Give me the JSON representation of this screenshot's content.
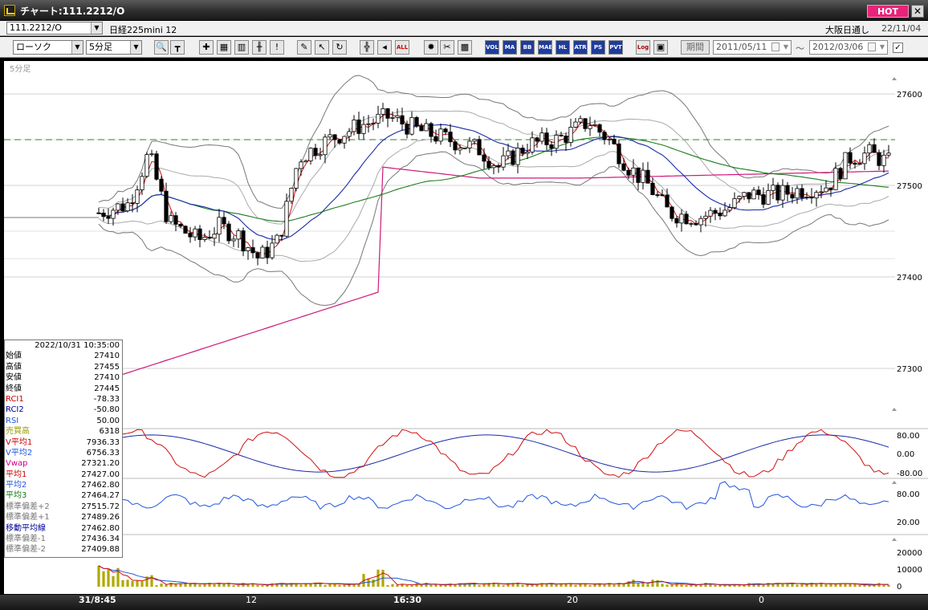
{
  "window": {
    "title": "チャート:111.2212/O",
    "hot_label": "HOT",
    "close_label": "✕"
  },
  "header": {
    "symbol": "111.2212/O",
    "instrument": "日経225mini 12",
    "session": "大阪日通し",
    "date": "22/11/04"
  },
  "toolbar": {
    "chart_type": "ローソク",
    "interval": "5分足",
    "buttons": [
      {
        "name": "zoom-icon",
        "label": "🔍"
      },
      {
        "name": "ruler-icon",
        "label": "┳"
      },
      {
        "name": "candle-select-icon",
        "label": "✚"
      },
      {
        "name": "chart-grid-icon",
        "label": "▦"
      },
      {
        "name": "bar-chart-icon",
        "label": "▥"
      },
      {
        "name": "candle-mark-icon",
        "label": "╫"
      },
      {
        "name": "warning-icon",
        "label": "!"
      },
      {
        "name": "pencil-icon",
        "label": "✎"
      },
      {
        "name": "cursor-icon",
        "label": "↖"
      },
      {
        "name": "rotate-icon",
        "label": "↻"
      },
      {
        "name": "ohlc-icon",
        "label": "╬"
      },
      {
        "name": "shift-left-icon",
        "label": "◂"
      },
      {
        "name": "all-icon",
        "label": "ALL"
      },
      {
        "name": "settings-icon",
        "label": "✹"
      },
      {
        "name": "wrench-icon",
        "label": "✂"
      },
      {
        "name": "palette-icon",
        "label": "▩"
      },
      {
        "name": "volume-icon",
        "label": "VOL"
      },
      {
        "name": "ma-icon",
        "label": "MA"
      },
      {
        "name": "bb-icon",
        "label": "BB"
      },
      {
        "name": "mae-icon",
        "label": "MAE"
      },
      {
        "name": "hl-icon",
        "label": "HL"
      },
      {
        "name": "atr-icon",
        "label": "ATR"
      },
      {
        "name": "ps-icon",
        "label": "PS"
      },
      {
        "name": "pvt-icon",
        "label": "PVT"
      },
      {
        "name": "log-icon",
        "label": "Log"
      },
      {
        "name": "chart-copy-icon",
        "label": "▣"
      }
    ],
    "period_label": "期間",
    "date_from": "2011/05/11",
    "date_to": "2012/03/06",
    "tilde": "〜",
    "check": "✓"
  },
  "chart": {
    "interval_label": "5分足",
    "price_ticks": [
      "27600",
      "27500",
      "27400",
      "27300"
    ],
    "osc_ticks": [
      "80.00",
      "0.00",
      "-80.00"
    ],
    "rsi_ticks": [
      "80.00",
      "20.00"
    ],
    "vol_ticks": [
      "20000",
      "10000",
      "0"
    ],
    "x_labels": [
      "31/8:45",
      "12",
      "16:30",
      "20",
      "0"
    ]
  },
  "data_panel": {
    "datetime": "2022/10/31  10:35:00",
    "rows": [
      {
        "k": "始値",
        "v": "27410",
        "color": "#000000"
      },
      {
        "k": "高値",
        "v": "27455",
        "color": "#000000"
      },
      {
        "k": "安値",
        "v": "27410",
        "color": "#000000"
      },
      {
        "k": "終値",
        "v": "27445",
        "color": "#000000"
      },
      {
        "k": "RCI1",
        "v": "-78.33",
        "color": "#cc0000"
      },
      {
        "k": "RCI2",
        "v": "-50.80",
        "color": "#000099"
      },
      {
        "k": "RSI",
        "v": "50.00",
        "color": "#2255dd"
      },
      {
        "k": "売買高",
        "v": "6318",
        "color": "#999900"
      },
      {
        "k": "V平均1",
        "v": "7936.33",
        "color": "#cc0000"
      },
      {
        "k": "V平均2",
        "v": "6756.33",
        "color": "#2255dd"
      },
      {
        "k": "Vwap",
        "v": "27321.20",
        "color": "#cc0088"
      },
      {
        "k": "平均1",
        "v": "27427.00",
        "color": "#cc0000"
      },
      {
        "k": "平均2",
        "v": "27462.80",
        "color": "#2255dd"
      },
      {
        "k": "平均3",
        "v": "27464.27",
        "color": "#117711"
      },
      {
        "k": "標準偏差+2",
        "v": "27515.72",
        "color": "#777777"
      },
      {
        "k": "標準偏差+1",
        "v": "27489.26",
        "color": "#777777"
      },
      {
        "k": "移動平均線",
        "v": "27462.80",
        "color": "#000099"
      },
      {
        "k": "標準偏差-1",
        "v": "27436.34",
        "color": "#777777"
      },
      {
        "k": "標準偏差-2",
        "v": "27409.88",
        "color": "#777777"
      }
    ]
  }
}
